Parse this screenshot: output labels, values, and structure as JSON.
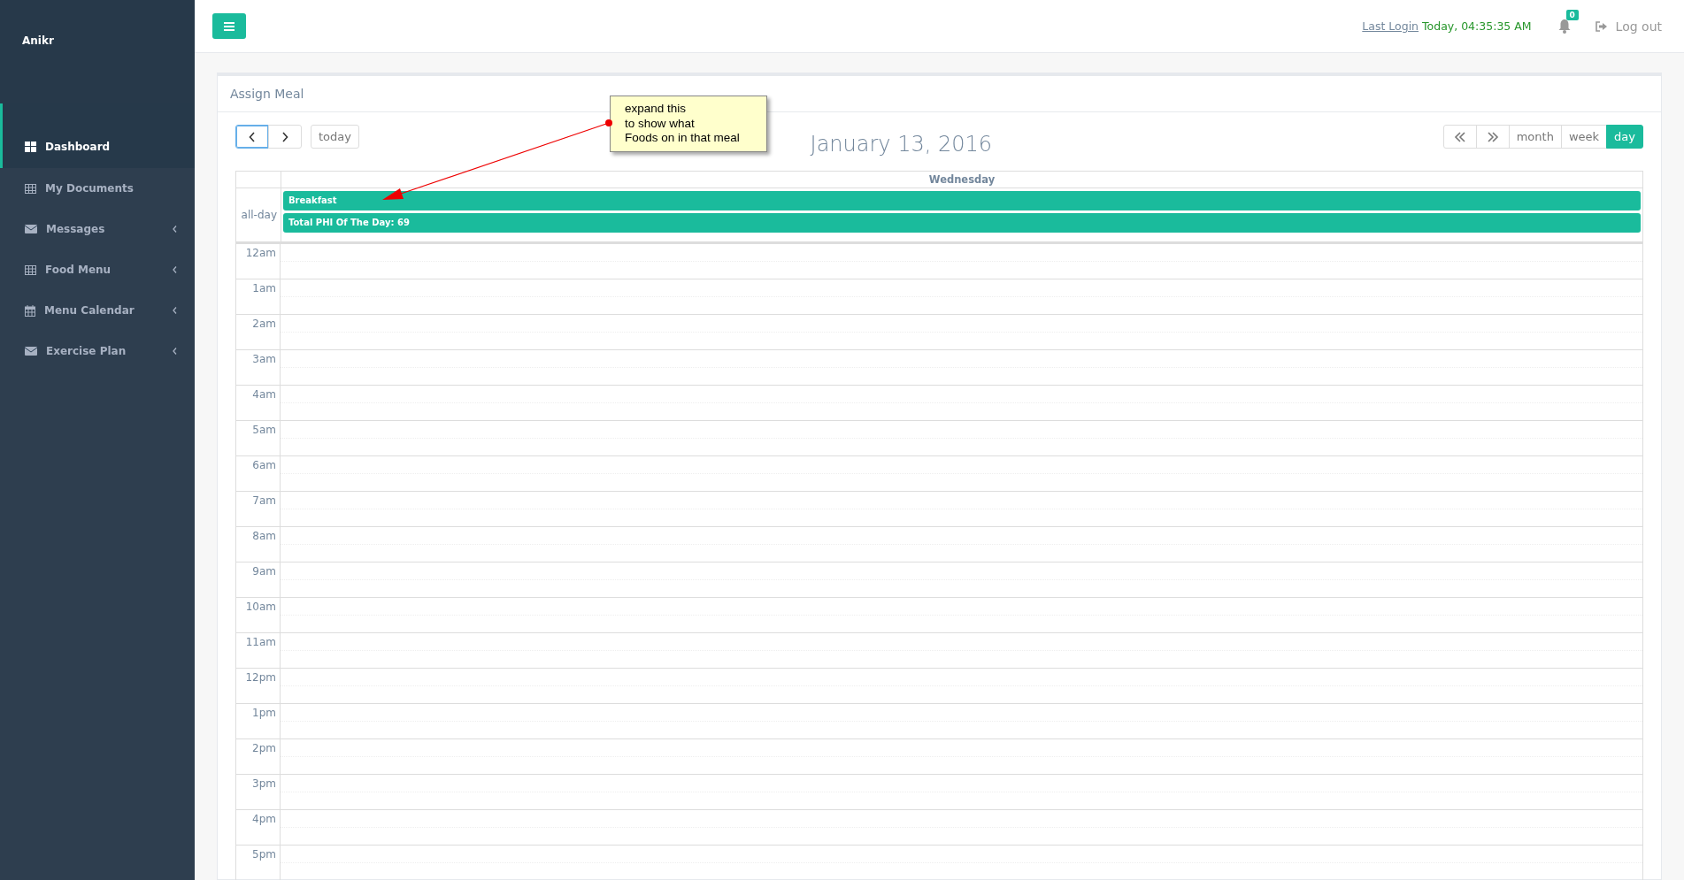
{
  "sidebar": {
    "brand": "Anikr",
    "items": [
      {
        "label": "Dashboard",
        "kind": "tiles",
        "selected": true,
        "has_submenu": false
      },
      {
        "label": "My Documents",
        "kind": "table",
        "selected": false,
        "has_submenu": false
      },
      {
        "label": "Messages",
        "kind": "envelope",
        "selected": false,
        "has_submenu": true
      },
      {
        "label": "Food Menu",
        "kind": "table",
        "selected": false,
        "has_submenu": true
      },
      {
        "label": "Menu Calendar",
        "kind": "calendar",
        "selected": false,
        "has_submenu": true
      },
      {
        "label": "Exercise Plan",
        "kind": "envelope",
        "selected": false,
        "has_submenu": true
      }
    ]
  },
  "header": {
    "last_login_label": "Last Login",
    "last_login_value": "Today, 04:35:35 AM",
    "notification_count": "0",
    "logout": "Log out"
  },
  "panel": {
    "title": "Assign Meal",
    "calendar": {
      "nav": [
        {
          "kind": "prev",
          "focused": true
        },
        {
          "kind": "next",
          "focused": false
        }
      ],
      "today": "today",
      "title": "January 13, 2016",
      "jumps": [
        {
          "kind": "prev-year"
        },
        {
          "kind": "next-year"
        }
      ],
      "views": [
        {
          "label": "month",
          "selected": false
        },
        {
          "label": "week",
          "selected": false
        },
        {
          "label": "day",
          "selected": true
        }
      ],
      "day_header": "Wednesday",
      "allday_label": "all-day",
      "events": [
        {
          "title": "Breakfast"
        },
        {
          "title": "Total PHI Of The Day: 69"
        }
      ],
      "hours": [
        "12am",
        "1am",
        "2am",
        "3am",
        "4am",
        "5am",
        "6am",
        "7am",
        "8am",
        "9am",
        "10am",
        "11am",
        "12pm",
        "1pm",
        "2pm",
        "3pm",
        "4pm",
        "5pm"
      ]
    }
  },
  "annotation": {
    "text": "expand this\nto show what\nFoods on in that meal"
  }
}
